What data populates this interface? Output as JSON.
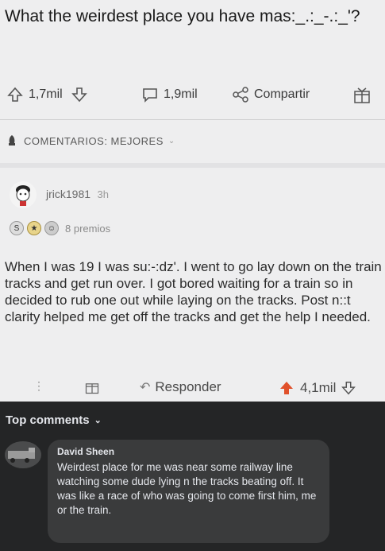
{
  "post": {
    "title": "What the weirdest place you have mas:_.:_-.:_'?",
    "upvotes": "1,7mil",
    "comments": "1,9mil",
    "share_label": "Compartir"
  },
  "comments_section": {
    "sort_label": "COMENTARIOS: MEJORES"
  },
  "comment": {
    "username": "jrick1981",
    "time": "3h",
    "awards_label": "8 premios",
    "body": "When I was 19 I was su:-:dz'. I went to go lay down on the train tracks and get run over. I got bored waiting for a train so in decided to rub one out while laying on the tracks. Post n::t clarity helped me get off the tracks and get the help I needed.",
    "reply_label": "Responder",
    "score": "4,1mil"
  },
  "facebook": {
    "top_comments_label": "Top comments",
    "commenter_name": "David Sheen",
    "comment_text": "Weirdest place for me was near some railway line watching some dude lying n the tracks beating off. It was like a race of who was going to come first him, me or the train."
  },
  "colors": {
    "upvote_active": "#e0502a",
    "dark_bg": "#242526",
    "bubble_bg": "#3a3b3c",
    "light_bg": "#eeeeef"
  }
}
